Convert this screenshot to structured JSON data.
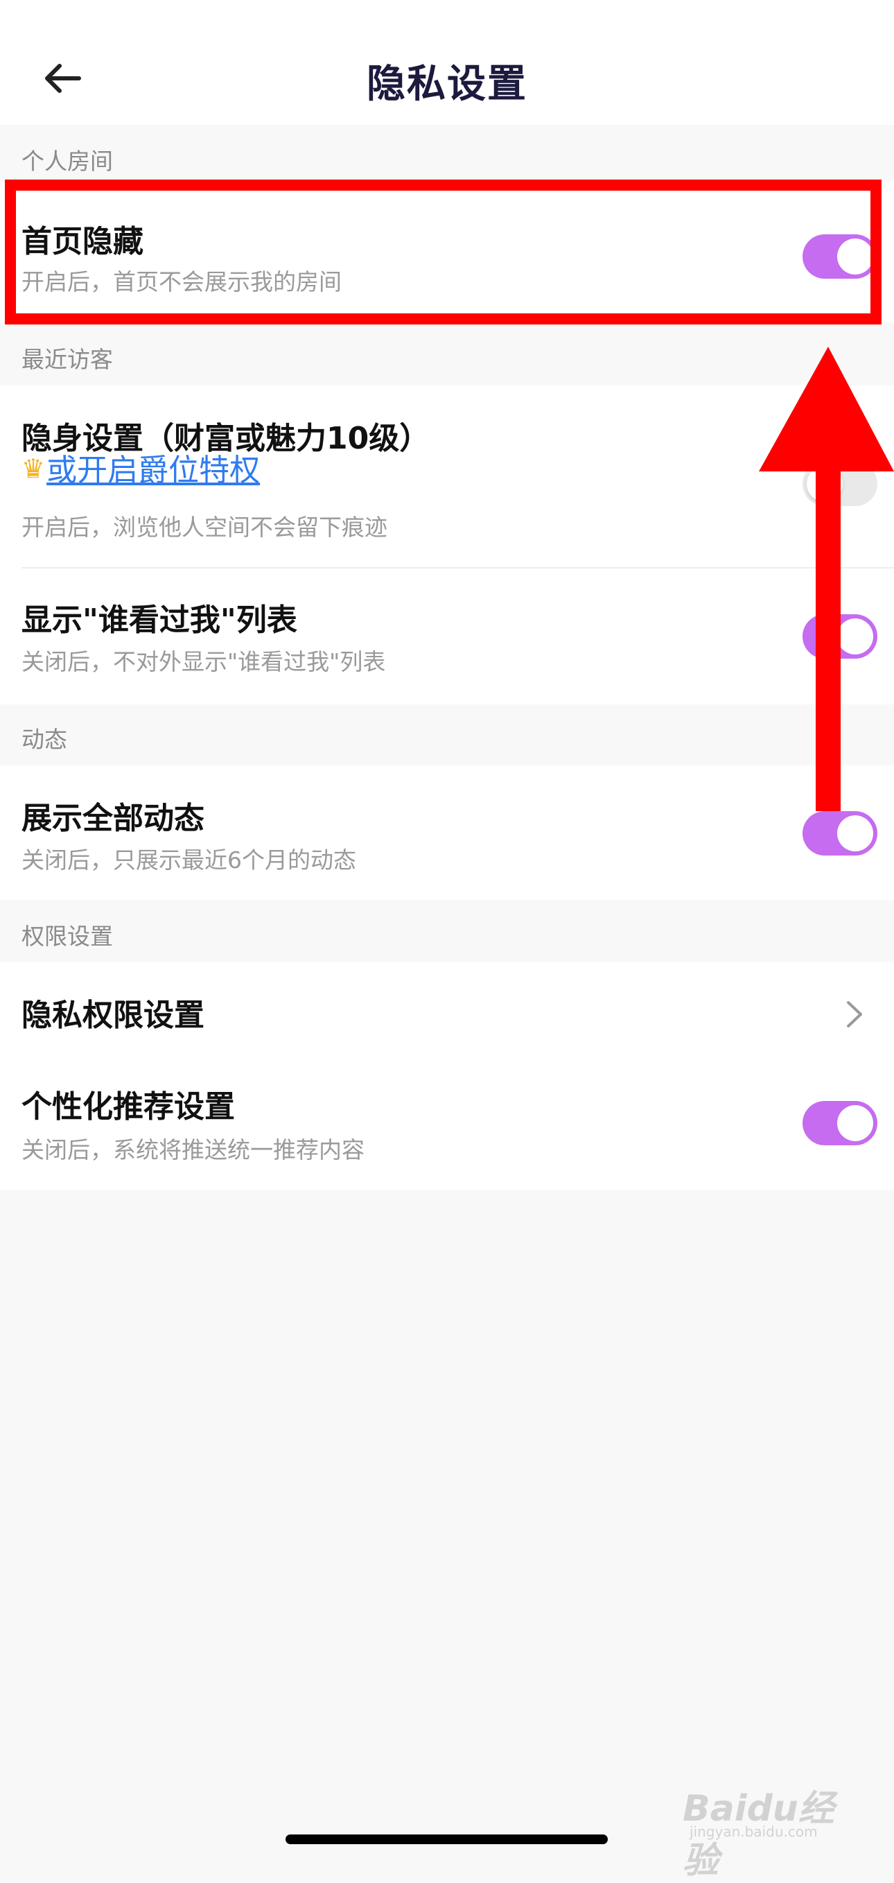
{
  "header": {
    "title": "隐私设置",
    "back_icon": "arrow-left-icon"
  },
  "sections": {
    "room": {
      "label": "个人房间",
      "homepage_hide": {
        "title": "首页隐藏",
        "subtitle": "开启后，首页不会展示我的房间",
        "enabled": true
      }
    },
    "visitors": {
      "label": "最近访客",
      "invisible": {
        "title": "隐身设置（财富或魅力10级）",
        "link_icon": "crown-icon",
        "link_text": "或开启爵位特权",
        "subtitle": "开启后，浏览他人空间不会留下痕迹",
        "enabled": false
      },
      "who_viewed": {
        "title": "显示\"谁看过我\"列表",
        "subtitle": "关闭后，不对外显示\"谁看过我\"列表",
        "enabled": true
      }
    },
    "moments": {
      "label": "动态",
      "show_all": {
        "title": "展示全部动态",
        "subtitle": "关闭后，只展示最近6个月的动态",
        "enabled": true
      }
    },
    "permissions": {
      "label": "权限设置",
      "privacy_permission": {
        "title": "隐私权限设置",
        "chevron_icon": "chevron-right-icon"
      },
      "personalized": {
        "title": "个性化推荐设置",
        "subtitle": "关闭后，系统将推送统一推荐内容",
        "enabled": true
      }
    }
  },
  "colors": {
    "toggle_on": "#c56cf0",
    "toggle_off": "#e9e9ea",
    "link": "#2f7bef",
    "annotation": "#ff0000"
  },
  "watermark": {
    "brand": "Baidu经验",
    "sub": "jingyan.baidu.com"
  }
}
